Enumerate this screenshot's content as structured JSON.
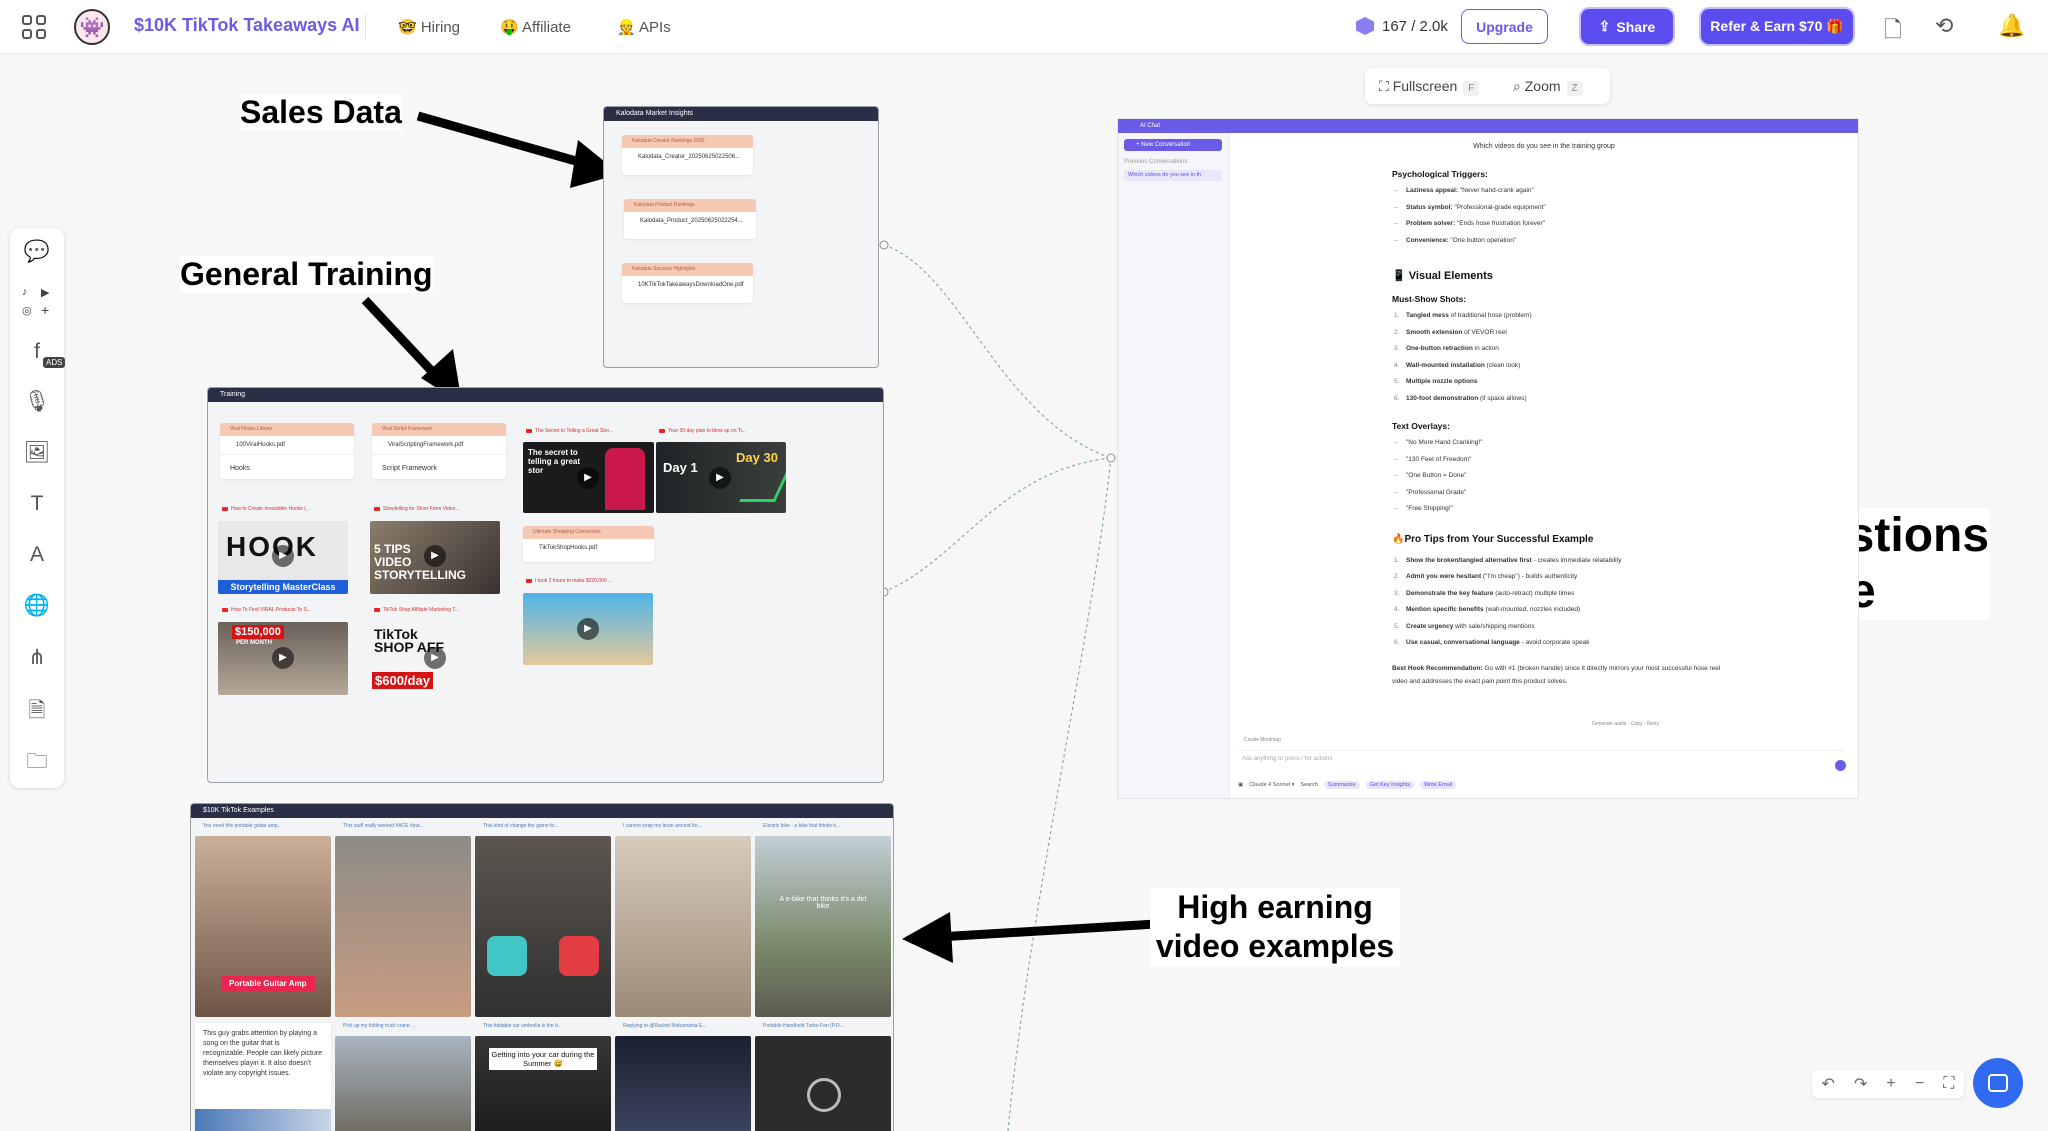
{
  "topbar": {
    "app_title": "$10K TikTok Takeaways AI",
    "nav": [
      "🤓 Hiring",
      "🤑 Affiliate",
      "👷 APIs"
    ],
    "credits": "167 / 2.0k",
    "upgrade_label": "Upgrade",
    "share_label": "Share",
    "refer_label": "Refer & Earn $70 🎁"
  },
  "annotations": {
    "sales_data": "Sales Data",
    "general_training": "General Training",
    "ask_line1": "Ask questions",
    "ask_line2": "here",
    "high_line1": "High earning",
    "high_line2": "video examples"
  },
  "kalodata": {
    "header": "Kalodata Market Insights",
    "cards": [
      {
        "title": "Kalodata Creator Rankings 2025",
        "file": "Kalodata_Creator_20250625022506..."
      },
      {
        "title": "Kalodata Product Rankings",
        "file": "Kalodata_Product_20250625022254..."
      },
      {
        "title": "Kalodata Success Highlights",
        "file": "10KTikTokTakeawaysDownloadOne.pdf"
      }
    ]
  },
  "training": {
    "header": "Training",
    "doc_cards": [
      {
        "title": "Viral Hooks Library",
        "file": "100ViralHooks.pdf",
        "sub": "Hooks"
      },
      {
        "title": "Viral Script Framework",
        "file": "ViralScriptingFramework.pdf",
        "sub": "Script Framework"
      },
      {
        "title": "Ultimate Shopping Conversion",
        "file": "TikTokShopHooks.pdf",
        "sub": ""
      }
    ],
    "videos": [
      {
        "cap": "The Secret to Telling a Great Stor...",
        "thumb": "The secret to telling a great stor"
      },
      {
        "cap": "Your 30 day plan to blow up on Ti...",
        "thumb_a": "Day 1",
        "thumb_b": "Day 30"
      },
      {
        "cap": "How to Create Irresistible Hooks (...",
        "thumb": "HOOK",
        "thumb_sub": "Storytelling MasterClass"
      },
      {
        "cap": "Storytelling for Short Form Video...",
        "thumb": "5 TIPS VIDEO STORYTELLING"
      },
      {
        "cap": "I took 2 hours to make $220,000 ...",
        "thumb": ""
      },
      {
        "cap": "How To Find VIRAL Products To S...",
        "thumb": "$150,000",
        "thumb_sub": "PER MONTH"
      },
      {
        "cap": "TikTok Shop Affiliate Marketing T...",
        "thumb": "TikTok SHOP AFF",
        "thumb_sub": "$600/day"
      }
    ]
  },
  "examples": {
    "header": "$10K TikTok Examples",
    "row1_caps": [
      "You need this portable guitar amp...",
      "This stuff really worked #ACE #put...",
      "This kind of change the game fo...",
      "I cannot wrap my brain around ho...",
      "Electric bike - a bike that thinks it..."
    ],
    "row1_labels": [
      "Portable Guitar Amp",
      "",
      "",
      "",
      "A e-bike that thinks it's a dirt bike"
    ],
    "row2_caps": [
      "",
      "Pick up my folding truck crane ...",
      "This foldable car umbrella is the b...",
      "Replying to @Rachel Mahamania E...",
      "Portable Handheld Turbo Fan (P.O..."
    ],
    "note": "This guy grabs attention by playing a song on the guitar that is recognizable. People can likely picture themselves playin it. It also doesn't violate any copyright issues.",
    "row2_label": "Getting into your car during the Summer 😅"
  },
  "viewcontrols": {
    "fullscreen": "Fullscreen",
    "fullscreen_key": "F",
    "zoom": "Zoom",
    "zoom_key": "Z"
  },
  "chat": {
    "header": "AI Chat",
    "new_conversation": "+ New Conversation",
    "previous": "Previous Conversations",
    "conv_item": "Which videos do you see in th",
    "question": "Which videos do you see in the training group",
    "psych_title": "Psychological Triggers:",
    "psych": [
      {
        "b": "Laziness appeal:",
        "t": " \"Never hand-crank again\""
      },
      {
        "b": "Status symbol:",
        "t": " \"Professional-grade equipment\""
      },
      {
        "b": "Problem solver:",
        "t": " \"Ends hose frustration forever\""
      },
      {
        "b": "Convenience:",
        "t": " \"One button operation\""
      }
    ],
    "visual_title": "📱 Visual Elements",
    "mustshow_title": "Must-Show Shots:",
    "mustshow": [
      {
        "b": "Tangled mess",
        "t": " of traditional hose (problem)"
      },
      {
        "b": "Smooth extension",
        "t": " of VEVOR reel"
      },
      {
        "b": "One-button retraction",
        "t": " in action"
      },
      {
        "b": "Wall-mounted installation",
        "t": " (clean look)"
      },
      {
        "b": "Multiple nozzle options",
        "t": ""
      },
      {
        "b": "130-foot demonstration",
        "t": " (if space allows)"
      }
    ],
    "overlay_title": "Text Overlays:",
    "overlays": [
      "\"No More Hand Cranking!\"",
      "\"130 Feet of Freedom\"",
      "\"One Button = Done\"",
      "\"Professional Grade\"",
      "\"Free Shipping!\""
    ],
    "protips_title": "🔥Pro Tips from Your Successful Example",
    "protips": [
      {
        "b": "Show the broken/tangled alternative first",
        "t": " - creates immediate relatability"
      },
      {
        "b": "Admit you were hesitant",
        "t": " (\"I'm cheap\") - builds authenticity"
      },
      {
        "b": "Demonstrate the key feature",
        "t": " (auto-retract) multiple times"
      },
      {
        "b": "Mention specific benefits",
        "t": " (wall-mounted, nozzles included)"
      },
      {
        "b": "Create urgency",
        "t": " with sale/shipping mentions"
      },
      {
        "b": "Use casual, conversational language",
        "t": " - avoid corporate speak"
      }
    ],
    "best_hook_b": "Best Hook Recommendation:",
    "best_hook_t": " Go with #1 (broken handle) since it directly mirrors your most successful hose reel video and addresses the exact pain point this product solves.",
    "msg_actions": "Generate audio · Copy · Retry",
    "mindmap": "Create Mindmap",
    "input_placeholder": "Ask anything or press / for actions",
    "model": "Claude 4 Sonnet ▾",
    "search": "Search",
    "chips": [
      "Summarize",
      "Get Key Insights",
      "Write Email"
    ]
  }
}
